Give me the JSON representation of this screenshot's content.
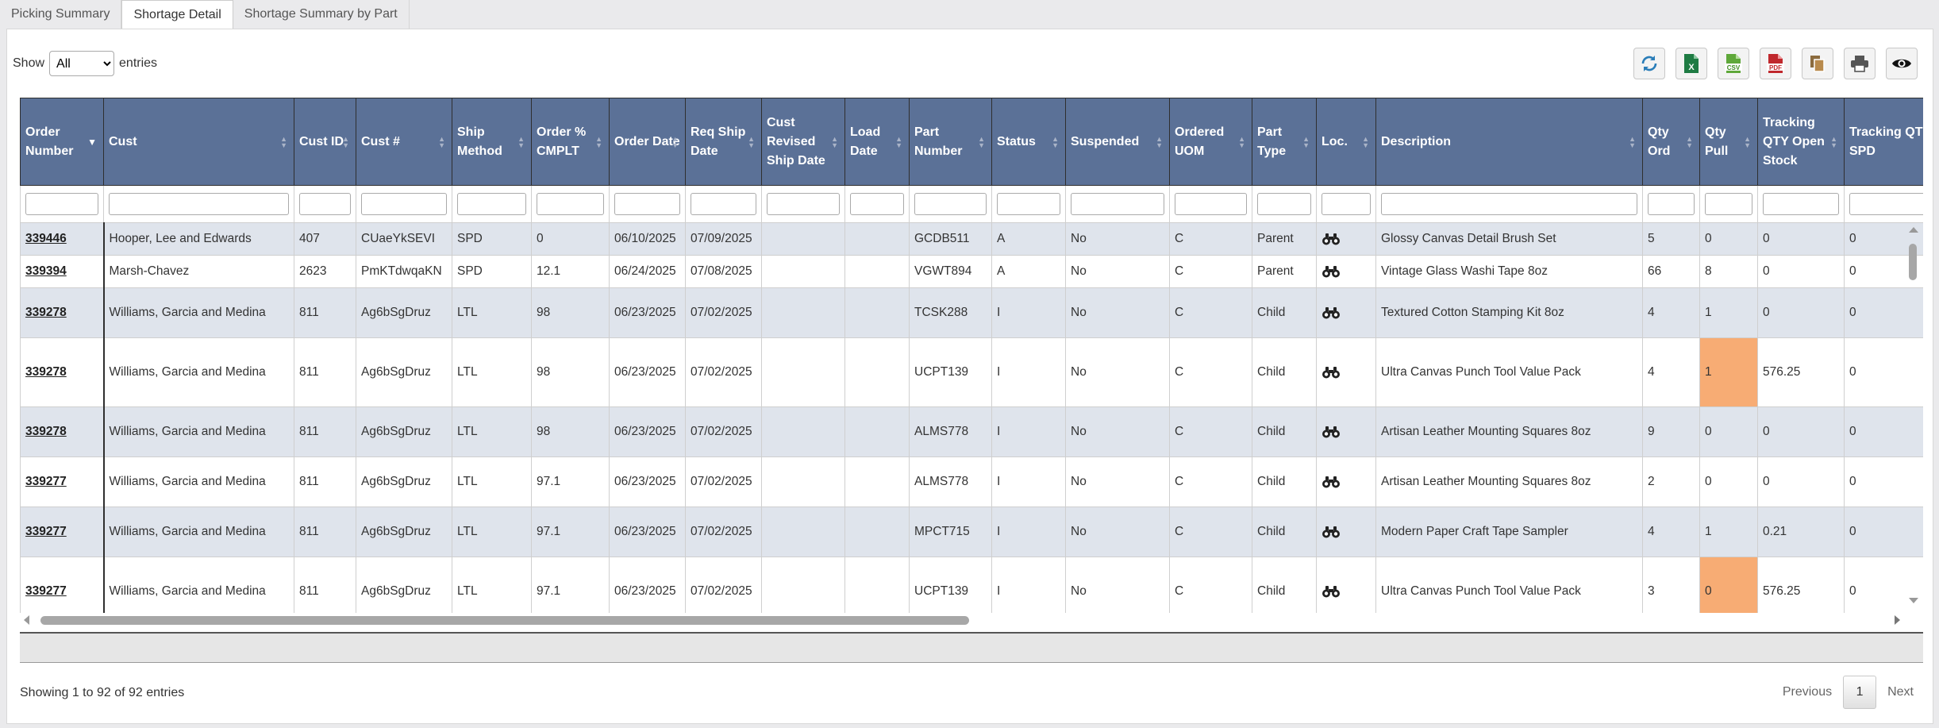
{
  "tabs": [
    "Picking Summary",
    "Shortage Detail",
    "Shortage Summary by Part"
  ],
  "length_control": {
    "prefix": "Show",
    "selected": "All",
    "suffix": "entries"
  },
  "toolbar": [
    "refresh-icon",
    "excel-icon",
    "csv-icon",
    "pdf-icon",
    "copy-icon",
    "print-icon",
    "eye-icon"
  ],
  "columns": [
    "Order Number",
    "Cust",
    "Cust ID",
    "Cust #",
    "Ship Method",
    "Order % CMPLT",
    "Order Date",
    "Req Ship Date",
    "Cust Revised Ship Date",
    "Load Date",
    "Part Number",
    "Status",
    "Suspended",
    "Ordered UOM",
    "Part Type",
    "Loc.",
    "Description",
    "Qty Ord",
    "Qty Pull",
    "Tracking QTY Open Stock",
    "Tracking QTY SPD"
  ],
  "rows": [
    {
      "order": "339446",
      "cust": "Hooper, Lee and Edwards",
      "cust_id": "407",
      "cust_no": "CUaeYkSEVI",
      "ship": "SPD",
      "pct": "0",
      "order_date": "06/10/2025",
      "req_ship": "07/09/2025",
      "revised": "",
      "load": "",
      "part": "GCDB511",
      "status": "A",
      "suspended": "No",
      "uom": "C",
      "ptype": "Parent",
      "desc": "Glossy Canvas Detail Brush Set",
      "qty_ord": "5",
      "qty_pull": "0",
      "open_stock": "0",
      "spd": "0"
    },
    {
      "order": "339394",
      "cust": "Marsh-Chavez",
      "cust_id": "2623",
      "cust_no": "PmKTdwqaKN",
      "ship": "SPD",
      "pct": "12.1",
      "order_date": "06/24/2025",
      "req_ship": "07/08/2025",
      "revised": "",
      "load": "",
      "part": "VGWT894",
      "status": "A",
      "suspended": "No",
      "uom": "C",
      "ptype": "Parent",
      "desc": "Vintage Glass Washi Tape 8oz",
      "qty_ord": "66",
      "qty_pull": "8",
      "open_stock": "0",
      "spd": "0"
    },
    {
      "order": "339278",
      "cust": "Williams, Garcia and Medina",
      "cust_id": "811",
      "cust_no": "Ag6bSgDruz",
      "ship": "LTL",
      "pct": "98",
      "order_date": "06/23/2025",
      "req_ship": "07/02/2025",
      "revised": "",
      "load": "",
      "part": "TCSK288",
      "status": "I",
      "suspended": "No",
      "uom": "C",
      "ptype": "Child",
      "desc": "Textured Cotton Stamping Kit 8oz",
      "qty_ord": "4",
      "qty_pull": "1",
      "open_stock": "0",
      "spd": "0"
    },
    {
      "order": "339278",
      "cust": "Williams, Garcia and Medina",
      "cust_id": "811",
      "cust_no": "Ag6bSgDruz",
      "ship": "LTL",
      "pct": "98",
      "order_date": "06/23/2025",
      "req_ship": "07/02/2025",
      "revised": "",
      "load": "",
      "part": "UCPT139",
      "status": "I",
      "suspended": "No",
      "uom": "C",
      "ptype": "Child",
      "desc": "Ultra Canvas Punch Tool Value Pack",
      "qty_ord": "4",
      "qty_pull": "1",
      "open_stock": "576.25",
      "spd": "0",
      "highlight_pull": true
    },
    {
      "order": "339278",
      "cust": "Williams, Garcia and Medina",
      "cust_id": "811",
      "cust_no": "Ag6bSgDruz",
      "ship": "LTL",
      "pct": "98",
      "order_date": "06/23/2025",
      "req_ship": "07/02/2025",
      "revised": "",
      "load": "",
      "part": "ALMS778",
      "status": "I",
      "suspended": "No",
      "uom": "C",
      "ptype": "Child",
      "desc": "Artisan Leather Mounting Squares 8oz",
      "qty_ord": "9",
      "qty_pull": "0",
      "open_stock": "0",
      "spd": "0"
    },
    {
      "order": "339277",
      "cust": "Williams, Garcia and Medina",
      "cust_id": "811",
      "cust_no": "Ag6bSgDruz",
      "ship": "LTL",
      "pct": "97.1",
      "order_date": "06/23/2025",
      "req_ship": "07/02/2025",
      "revised": "",
      "load": "",
      "part": "ALMS778",
      "status": "I",
      "suspended": "No",
      "uom": "C",
      "ptype": "Child",
      "desc": "Artisan Leather Mounting Squares 8oz",
      "qty_ord": "2",
      "qty_pull": "0",
      "open_stock": "0",
      "spd": "0"
    },
    {
      "order": "339277",
      "cust": "Williams, Garcia and Medina",
      "cust_id": "811",
      "cust_no": "Ag6bSgDruz",
      "ship": "LTL",
      "pct": "97.1",
      "order_date": "06/23/2025",
      "req_ship": "07/02/2025",
      "revised": "",
      "load": "",
      "part": "MPCT715",
      "status": "I",
      "suspended": "No",
      "uom": "C",
      "ptype": "Child",
      "desc": "Modern Paper Craft Tape Sampler",
      "qty_ord": "4",
      "qty_pull": "1",
      "open_stock": "0.21",
      "spd": "0"
    },
    {
      "order": "339277",
      "cust": "Williams, Garcia and Medina",
      "cust_id": "811",
      "cust_no": "Ag6bSgDruz",
      "ship": "LTL",
      "pct": "97.1",
      "order_date": "06/23/2025",
      "req_ship": "07/02/2025",
      "revised": "",
      "load": "",
      "part": "UCPT139",
      "status": "I",
      "suspended": "No",
      "uom": "C",
      "ptype": "Child",
      "desc": "Ultra Canvas Punch Tool Value Pack",
      "qty_ord": "3",
      "qty_pull": "0",
      "open_stock": "576.25",
      "spd": "0",
      "highlight_pull": true
    }
  ],
  "info": "Showing 1 to 92 of 92 entries",
  "pager": {
    "previous": "Previous",
    "current": "1",
    "next": "Next"
  },
  "colors": {
    "header_bg": "#5b7197",
    "stripe": "#dfe4ec",
    "highlight": "#f7ac74"
  }
}
